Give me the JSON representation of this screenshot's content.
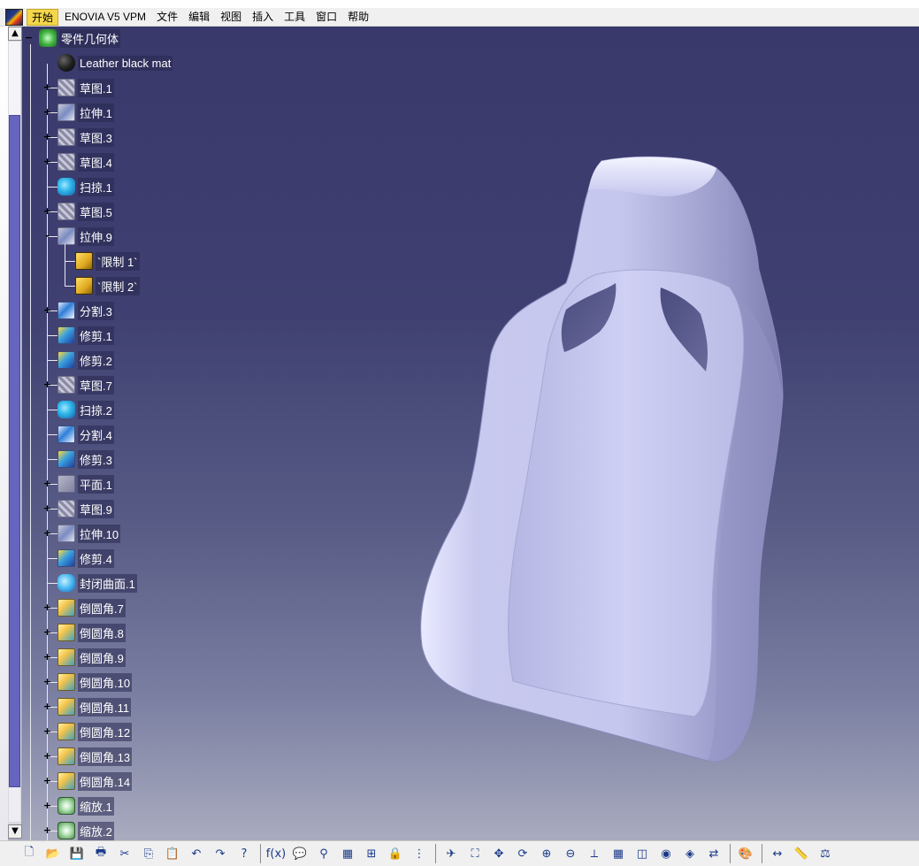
{
  "menu": {
    "items": [
      "开始",
      "ENOVIA V5 VPM",
      "文件",
      "编辑",
      "视图",
      "插入",
      "工具",
      "窗口",
      "帮助"
    ],
    "active_index": 0
  },
  "tree": {
    "root": "零件几何体",
    "material": "Leather black mat",
    "nodes": [
      {
        "label": "草图.1",
        "icon": "sketch-icon",
        "expander": "+"
      },
      {
        "label": "拉伸.1",
        "icon": "pad-icon",
        "expander": "+"
      },
      {
        "label": "草图.3",
        "icon": "sketch-icon",
        "expander": "+"
      },
      {
        "label": "草图.4",
        "icon": "sketch-icon",
        "expander": "+"
      },
      {
        "label": "扫掠.1",
        "icon": "sweep-icon",
        "expander": ""
      },
      {
        "label": "草图.5",
        "icon": "sketch-icon",
        "expander": "+"
      },
      {
        "label": "拉伸.9",
        "icon": "pad-icon",
        "expander": "-"
      },
      {
        "label": "`限制 1`",
        "icon": "limit-icon",
        "expander": "",
        "child": true
      },
      {
        "label": "`限制 2`",
        "icon": "limit-icon",
        "expander": "",
        "child": true
      },
      {
        "label": "分割.3",
        "icon": "split-icon",
        "expander": "+"
      },
      {
        "label": "修剪.1",
        "icon": "trim-icon",
        "expander": ""
      },
      {
        "label": "修剪.2",
        "icon": "trim-icon",
        "expander": ""
      },
      {
        "label": "草图.7",
        "icon": "sketch-icon",
        "expander": "+"
      },
      {
        "label": "扫掠.2",
        "icon": "sweep-icon",
        "expander": ""
      },
      {
        "label": "分割.4",
        "icon": "split-icon",
        "expander": ""
      },
      {
        "label": "修剪.3",
        "icon": "trim-icon",
        "expander": ""
      },
      {
        "label": "平面.1",
        "icon": "plane-icon",
        "expander": "+"
      },
      {
        "label": "草图.9",
        "icon": "sketch-icon",
        "expander": "+"
      },
      {
        "label": "拉伸.10",
        "icon": "pad-icon",
        "expander": "+"
      },
      {
        "label": "修剪.4",
        "icon": "trim-icon",
        "expander": ""
      },
      {
        "label": "封闭曲面.1",
        "icon": "close-surface-icon",
        "expander": ""
      },
      {
        "label": "倒圆角.7",
        "icon": "fillet-icon",
        "expander": "+"
      },
      {
        "label": "倒圆角.8",
        "icon": "fillet-icon",
        "expander": "+"
      },
      {
        "label": "倒圆角.9",
        "icon": "fillet-icon",
        "expander": "+"
      },
      {
        "label": "倒圆角.10",
        "icon": "fillet-icon",
        "expander": "+"
      },
      {
        "label": "倒圆角.11",
        "icon": "fillet-icon",
        "expander": "+"
      },
      {
        "label": "倒圆角.12",
        "icon": "fillet-icon",
        "expander": "+"
      },
      {
        "label": "倒圆角.13",
        "icon": "fillet-icon",
        "expander": "+"
      },
      {
        "label": "倒圆角.14",
        "icon": "fillet-icon",
        "expander": "+"
      },
      {
        "label": "缩放.1",
        "icon": "scale-icon",
        "expander": "+"
      },
      {
        "label": "缩放.2",
        "icon": "scale-icon",
        "expander": "+"
      }
    ]
  },
  "scrollbar": {
    "up_arrow": "▲",
    "down_arrow": "▼"
  },
  "toolbar": {
    "groups": [
      [
        "new-icon",
        "open-icon",
        "save-icon",
        "print-icon",
        "cut-icon",
        "copy-icon",
        "paste-icon",
        "undo-icon",
        "redo-icon",
        "whats-this-icon"
      ],
      [
        "formula-icon",
        "comment-icon",
        "knowledge-icon",
        "table-icon",
        "tree-icon",
        "lock-icon",
        "catalog-icon"
      ],
      [
        "fly-icon",
        "fit-all-icon",
        "pan-icon",
        "rotate-icon",
        "zoom-in-icon",
        "zoom-out-icon",
        "normal-view-icon",
        "multi-view-icon",
        "iso-view-icon",
        "shading-icon",
        "hide-show-icon",
        "swap-icon"
      ],
      [
        "apply-material-icon"
      ],
      [
        "measure-between-icon",
        "measure-item-icon",
        "measure-inertia-icon"
      ]
    ],
    "glyphs": {
      "new-icon": "🗋",
      "open-icon": "📂",
      "save-icon": "💾",
      "print-icon": "🖶",
      "cut-icon": "✂",
      "copy-icon": "⎘",
      "paste-icon": "📋",
      "undo-icon": "↶",
      "redo-icon": "↷",
      "whats-this-icon": "?",
      "formula-icon": "f(x)",
      "comment-icon": "💬",
      "knowledge-icon": "⚲",
      "table-icon": "▦",
      "tree-icon": "⊞",
      "lock-icon": "🔒",
      "catalog-icon": "⋮",
      "fly-icon": "✈",
      "fit-all-icon": "⛶",
      "pan-icon": "✥",
      "rotate-icon": "⟳",
      "zoom-in-icon": "⊕",
      "zoom-out-icon": "⊖",
      "normal-view-icon": "⟂",
      "multi-view-icon": "▦",
      "iso-view-icon": "◫",
      "shading-icon": "◉",
      "hide-show-icon": "◈",
      "swap-icon": "⇄",
      "apply-material-icon": "🎨",
      "measure-between-icon": "↔",
      "measure-item-icon": "📏",
      "measure-inertia-icon": "⚖"
    }
  },
  "colors": {
    "background_top": "#39396b",
    "background_bottom": "#a9abbf",
    "seat_surface": "#c3c4ea",
    "selection_yellow": "#f4d64b"
  }
}
